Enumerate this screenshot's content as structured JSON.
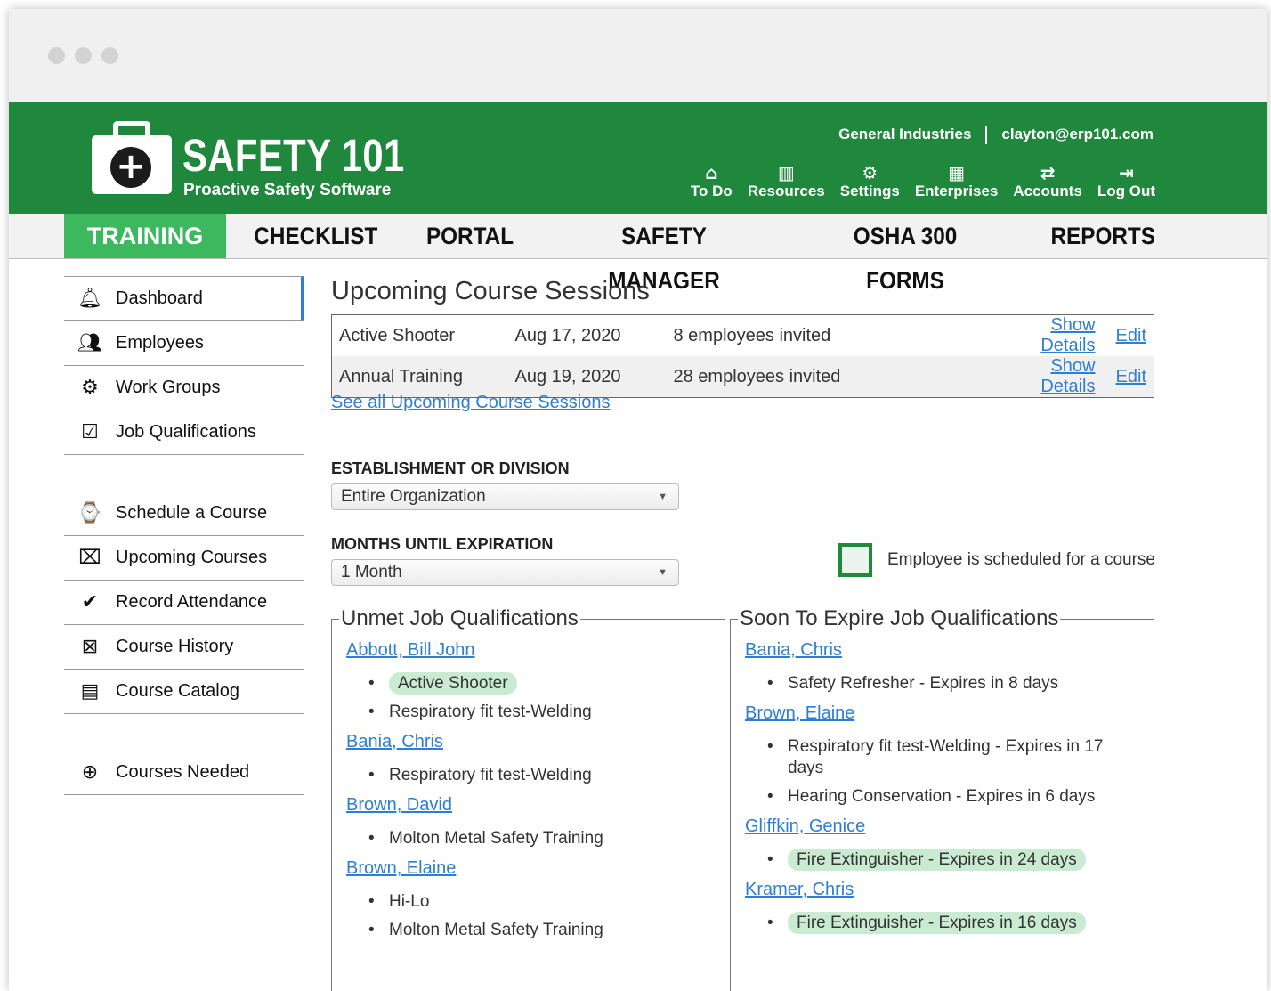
{
  "brand": {
    "name": "SAFETY 101",
    "tagline": "Proactive Safety Software"
  },
  "account": {
    "company": "General Industries",
    "email": "clayton@erp101.com"
  },
  "tools": [
    {
      "label": "To Do",
      "icon": "home-icon"
    },
    {
      "label": "Resources",
      "icon": "book-icon"
    },
    {
      "label": "Settings",
      "icon": "gear-icon"
    },
    {
      "label": "Enterprises",
      "icon": "building-icon"
    },
    {
      "label": "Accounts",
      "icon": "swap-arrows-icon"
    },
    {
      "label": "Log Out",
      "icon": "logout-icon"
    }
  ],
  "mainnav": [
    "TRAINING",
    "CHECKLIST",
    "PORTAL",
    "SAFETY MANAGER",
    "OSHA 300 FORMS",
    "REPORTS"
  ],
  "sidebar": [
    {
      "label": "Dashboard",
      "icon": "bell-icon"
    },
    {
      "label": "Employees",
      "icon": "people-icon"
    },
    {
      "label": "Work Groups",
      "icon": "group-gear-icon"
    },
    {
      "label": "Job Qualifications",
      "icon": "checklist-icon"
    },
    {
      "label": "Schedule a Course",
      "icon": "calendar-clock-icon"
    },
    {
      "label": "Upcoming Courses",
      "icon": "presentation-icon"
    },
    {
      "label": "Record Attendance",
      "icon": "attendance-icon"
    },
    {
      "label": "Course History",
      "icon": "course-history-icon"
    },
    {
      "label": "Course Catalog",
      "icon": "catalog-icon"
    },
    {
      "label": "Courses Needed",
      "icon": "courses-needed-icon"
    }
  ],
  "main": {
    "title": "Upcoming Course Sessions",
    "sessions": [
      {
        "course": "Active Shooter",
        "date": "Aug 17, 2020",
        "invited": "8 employees invited",
        "details": "Show Details",
        "edit": "Edit"
      },
      {
        "course": "Annual Training",
        "date": "Aug 19, 2020",
        "invited": "28 employees invited",
        "details": "Show Details",
        "edit": "Edit"
      }
    ],
    "see_all": "See all Upcoming Course Sessions",
    "establishment_label": "ESTABLISHMENT OR DIVISION",
    "establishment_value": "Entire Organization",
    "months_label": "MONTHS UNTIL EXPIRATION",
    "months_value": "1 Month",
    "legend_text": "Employee is scheduled for a course",
    "highlight_color": "#c9ebd2",
    "brand_green": "#20883d",
    "active_tab_green": "#3cb95f"
  },
  "unmet": {
    "title": "Unmet Job Qualifications",
    "employees": [
      {
        "name": "Abbott, Bill John",
        "items": [
          "Active Shooter",
          "Respiratory fit test-Welding"
        ]
      },
      {
        "name": "Bania, Chris",
        "items": [
          "Respiratory fit test-Welding"
        ]
      },
      {
        "name": "Brown, David",
        "items": [
          "Molton Metal Safety Training"
        ]
      },
      {
        "name": "Brown, Elaine",
        "items": [
          "Hi-Lo",
          "Molton Metal Safety Training"
        ]
      }
    ]
  },
  "expiring": {
    "title": "Soon To Expire Job Qualifications",
    "employees": [
      {
        "name": "Bania, Chris",
        "items": [
          "Safety Refresher - Expires in 8 days"
        ]
      },
      {
        "name": "Brown, Elaine",
        "items": [
          "Respiratory fit test-Welding - Expires in 17 days",
          "Hearing Conservation - Expires in 6 days"
        ]
      },
      {
        "name": "Gliffkin, Genice",
        "items": [
          "Fire Extinguisher - Expires in 24 days"
        ]
      },
      {
        "name": "Kramer, Chris",
        "items": [
          "Fire Extinguisher - Expires in 16 days"
        ]
      }
    ]
  }
}
